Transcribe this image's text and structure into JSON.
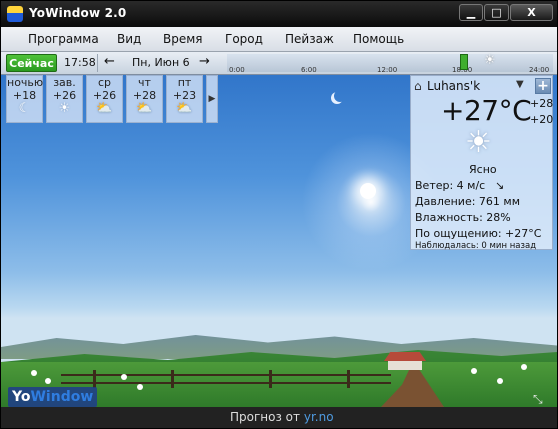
{
  "window": {
    "title": "YoWindow 2.0",
    "min_icon": "minimize-icon",
    "max_icon": "maximize-icon",
    "close_label": "X"
  },
  "menu": {
    "items": [
      "Программа",
      "Вид",
      "Время",
      "Город",
      "Пейзаж",
      "Помощь"
    ]
  },
  "timeline": {
    "now_label": "Сейчас",
    "time": "17:58",
    "prev_arrow": "←",
    "date": "Пн, Июн 6",
    "next_arrow": "→",
    "ticks": [
      "0:00",
      "6:00",
      "12:00",
      "18:00",
      "24:00"
    ]
  },
  "forecast": {
    "days": [
      {
        "name": "ночью",
        "temp": "+18",
        "icon": "moon-icon",
        "glyph": "☾"
      },
      {
        "name": "зав.",
        "temp": "+26",
        "icon": "sun-icon",
        "glyph": "☀"
      },
      {
        "name": "ср",
        "temp": "+26",
        "icon": "partly-cloudy-icon",
        "glyph": "⛅"
      },
      {
        "name": "чт",
        "temp": "+28",
        "icon": "partly-cloudy-icon",
        "glyph": "⛅"
      },
      {
        "name": "пт",
        "temp": "+23",
        "icon": "partly-cloudy-icon",
        "glyph": "⛅"
      }
    ],
    "next_glyph": "▶"
  },
  "current": {
    "city": "Luhans'k",
    "temperature": "+27°C",
    "high": "+28",
    "low": "+20",
    "condition": "Ясно",
    "wind": "Ветер:  4 м/с",
    "wind_dir": "↘",
    "pressure": "Давление:  761 мм",
    "humidity": "Влажность:  28%",
    "feels": "По ощущению:   +27°C",
    "observed": "Наблюдалась:  0 мин назад"
  },
  "brand": {
    "logo_prefix": "Yo",
    "logo_suffix": "Window"
  },
  "status": {
    "prefix": "Прогноз от",
    "link": "yr.no"
  }
}
